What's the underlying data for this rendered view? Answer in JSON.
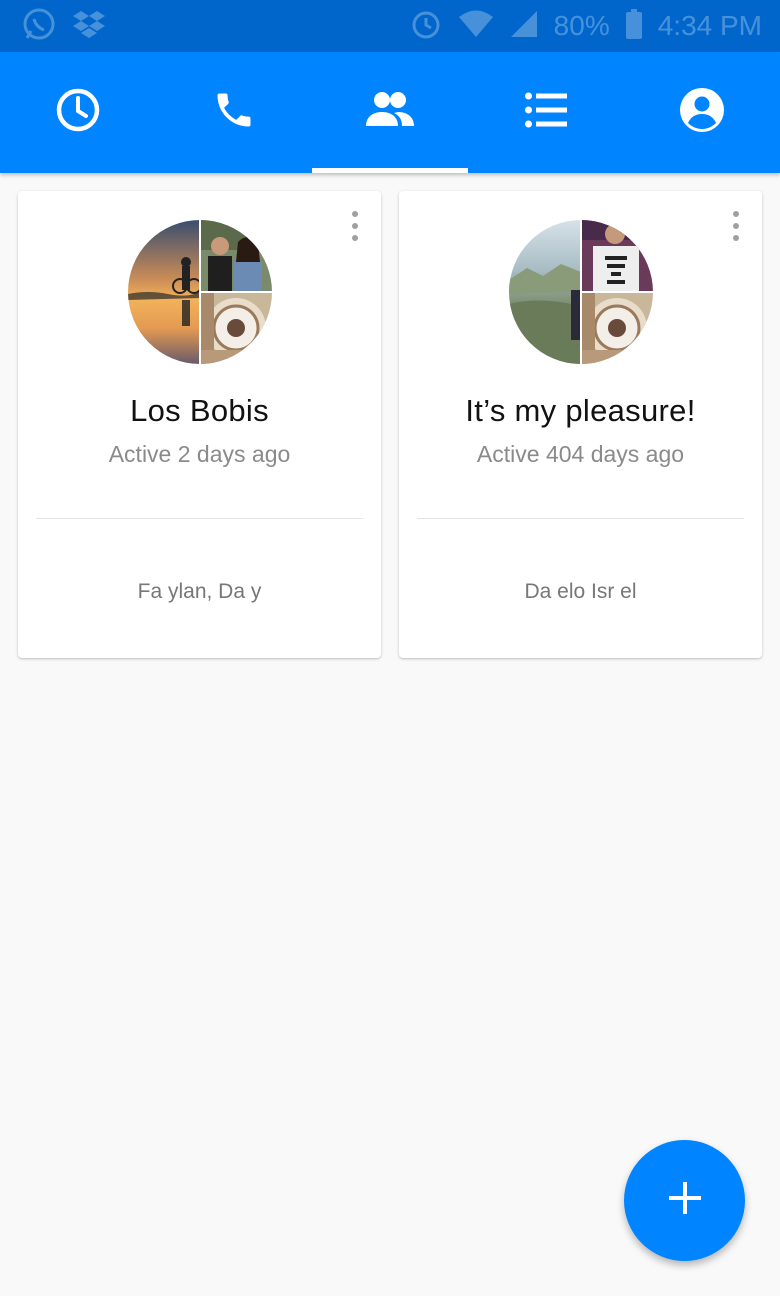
{
  "status_bar": {
    "left_icons": [
      "whatsapp-icon",
      "dropbox-icon"
    ],
    "right_icons": [
      "alarm-icon",
      "wifi-icon",
      "signal-icon"
    ],
    "battery": "80%",
    "time": "4:34 PM"
  },
  "tabs": [
    {
      "icon": "clock-icon",
      "label": "Recent",
      "active": false
    },
    {
      "icon": "phone-icon",
      "label": "Calls",
      "active": false
    },
    {
      "icon": "groups-icon",
      "label": "Groups",
      "active": true
    },
    {
      "icon": "list-icon",
      "label": "People",
      "active": false
    },
    {
      "icon": "account-icon",
      "label": "Profile",
      "active": false
    }
  ],
  "groups": [
    {
      "name": "Los Bobis",
      "activity": "Active 2 days ago",
      "members": "Fa ylan, Da y"
    },
    {
      "name": "It’s my pleasure!",
      "activity": "Active 404 days ago",
      "members": "Da elo Isr el"
    }
  ],
  "fab": {
    "icon": "plus-icon"
  },
  "colors": {
    "status_bar": "#0066cc",
    "primary": "#0084ff",
    "background": "#f9f9f9",
    "card": "#ffffff",
    "title_text": "#111111",
    "secondary_text": "#8a8a8a"
  }
}
